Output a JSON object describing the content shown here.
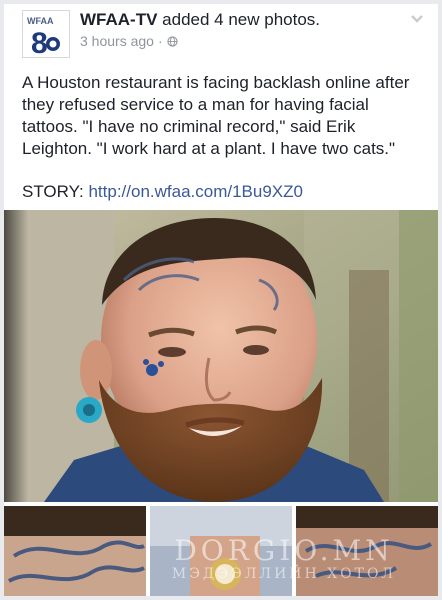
{
  "post": {
    "page_name": "WFAA-TV",
    "action": " added 4 new photos.",
    "time": "3 hours ago",
    "dot": "·",
    "avatar_logo_text": "WFAA",
    "avatar_channel": "8",
    "text": "A Houston restaurant is facing backlash online after they refused service to a man for having facial tattoos. \"I have no criminal record,\" said Erik Leighton. \"I work hard at a plant. I have two cats.\"",
    "story_label": "STORY: ",
    "story_link": "http://on.wfaa.com/1Bu9XZ0"
  },
  "watermark": {
    "line1": "DORGIO.MN",
    "line2": "МЭДЭЭЛЛИЙН ХОТОЛ"
  },
  "icons": {
    "globe": "globe-icon",
    "chevron": "chevron-down-icon"
  },
  "colors": {
    "link": "#3b5998",
    "meta": "#90949c",
    "text": "#1d2129",
    "beard": "#7a4a2a"
  }
}
